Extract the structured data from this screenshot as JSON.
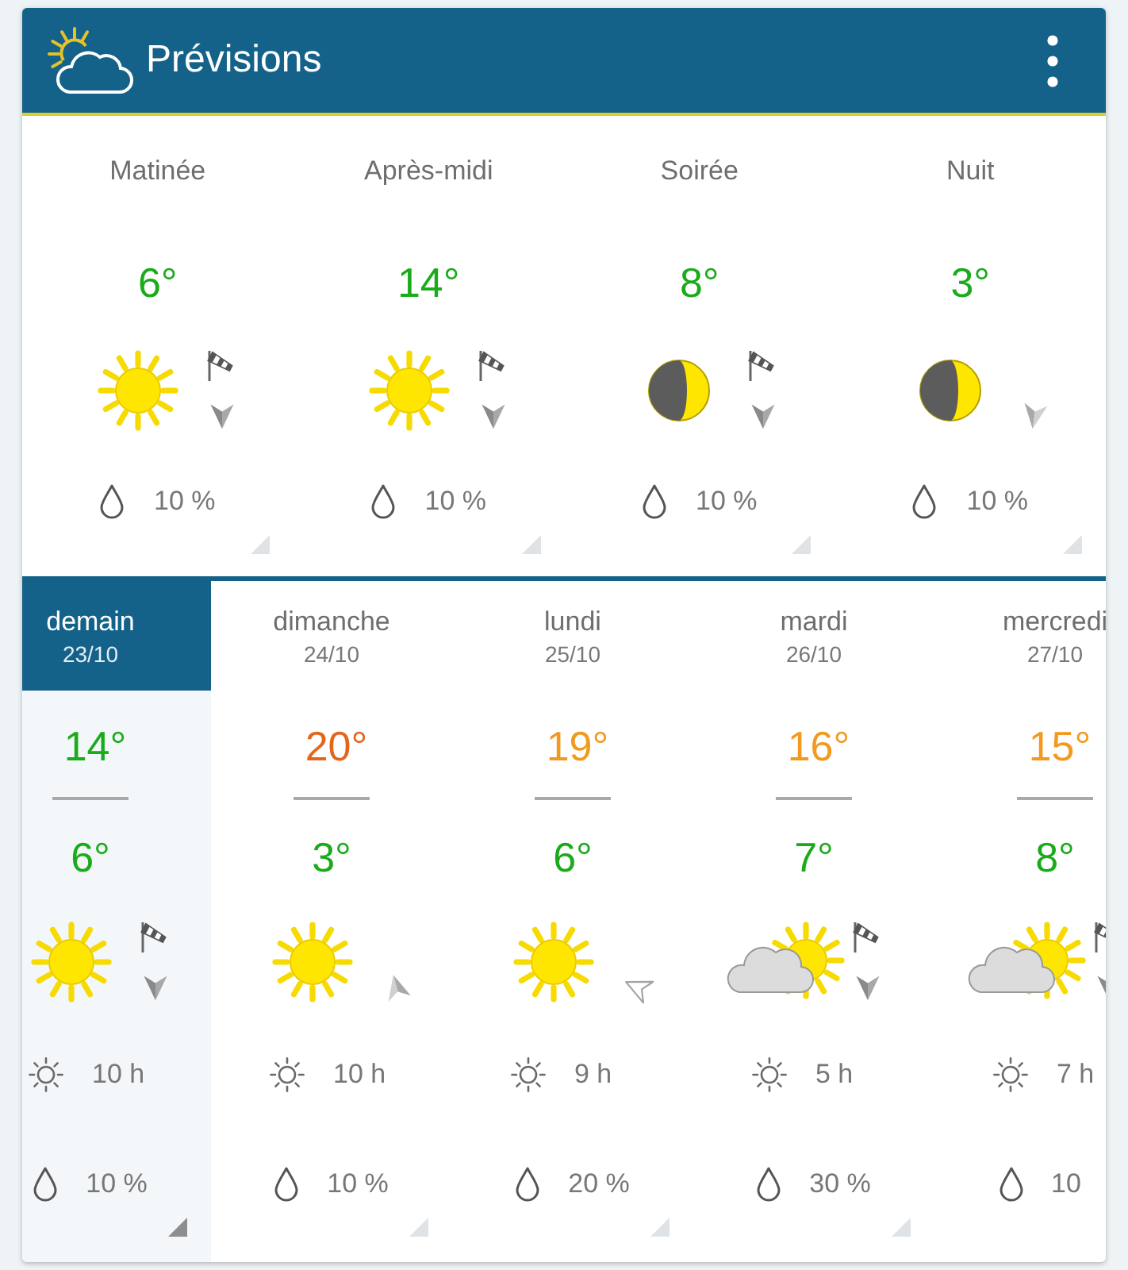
{
  "header": {
    "title": "Prévisions"
  },
  "periods": [
    {
      "label": "Matinée",
      "temperature": {
        "text": "6°",
        "color": "#1aab1a"
      },
      "sky": {
        "kind": "sun"
      },
      "wind": {
        "windsock": true,
        "arrow": {
          "kind": "south-dark"
        }
      },
      "precipitation": "10 %"
    },
    {
      "label": "Après-midi",
      "temperature": {
        "text": "14°",
        "color": "#1aab1a"
      },
      "sky": {
        "kind": "sun"
      },
      "wind": {
        "windsock": true,
        "arrow": {
          "kind": "south-dark"
        }
      },
      "precipitation": "10 %"
    },
    {
      "label": "Soirée",
      "temperature": {
        "text": "8°",
        "color": "#1aab1a"
      },
      "sky": {
        "kind": "moon"
      },
      "wind": {
        "windsock": true,
        "arrow": {
          "kind": "south-dark"
        }
      },
      "precipitation": "10 %"
    },
    {
      "label": "Nuit",
      "temperature": {
        "text": "3°",
        "color": "#1aab1a"
      },
      "sky": {
        "kind": "moon"
      },
      "wind": {
        "windsock": false,
        "arrow": {
          "kind": "south-light"
        }
      },
      "precipitation": "10 %"
    }
  ],
  "days": [
    {
      "name": "demain",
      "date": "23/10",
      "selected": true,
      "high": {
        "text": "14°",
        "color": "#1aab1a"
      },
      "low": {
        "text": "6°",
        "color": "#1aab1a"
      },
      "sky": {
        "kind": "sun"
      },
      "wind": {
        "windsock": true,
        "arrow": {
          "kind": "south-dark"
        }
      },
      "sunshine": "10 h",
      "precipitation": "10 %"
    },
    {
      "name": "dimanche",
      "date": "24/10",
      "selected": false,
      "high": {
        "text": "20°",
        "color": "#e4661c"
      },
      "low": {
        "text": "3°",
        "color": "#1aab1a"
      },
      "sky": {
        "kind": "sun"
      },
      "wind": {
        "windsock": false,
        "arrow": {
          "kind": "north-light"
        }
      },
      "sunshine": "10 h",
      "precipitation": "10 %"
    },
    {
      "name": "lundi",
      "date": "25/10",
      "selected": false,
      "high": {
        "text": "19°",
        "color": "#f29a1f"
      },
      "low": {
        "text": "6°",
        "color": "#1aab1a"
      },
      "sky": {
        "kind": "sun"
      },
      "wind": {
        "windsock": false,
        "arrow": {
          "kind": "west-outline"
        }
      },
      "sunshine": "9 h",
      "precipitation": "20 %"
    },
    {
      "name": "mardi",
      "date": "26/10",
      "selected": false,
      "high": {
        "text": "16°",
        "color": "#f29a1f"
      },
      "low": {
        "text": "7°",
        "color": "#1aab1a"
      },
      "sky": {
        "kind": "sun-cloud"
      },
      "wind": {
        "windsock": true,
        "arrow": {
          "kind": "south-dark"
        }
      },
      "sunshine": "5 h",
      "precipitation": "30 %"
    },
    {
      "name": "mercredi",
      "date": "27/10",
      "selected": false,
      "high": {
        "text": "15°",
        "color": "#f29a1f"
      },
      "low": {
        "text": "8°",
        "color": "#1aab1a"
      },
      "sky": {
        "kind": "sun-cloud"
      },
      "wind": {
        "windsock": true,
        "arrow": {
          "kind": "south-dark"
        }
      },
      "sunshine": "7 h",
      "precipitation": "10"
    }
  ]
}
